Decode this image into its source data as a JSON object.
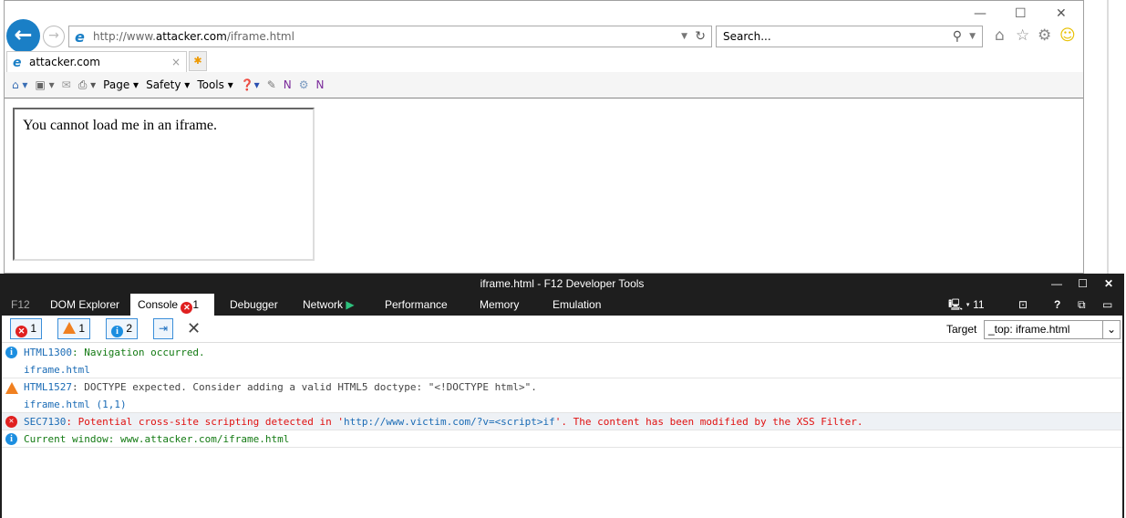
{
  "browser": {
    "url_prefix": "http://www.",
    "url_domain": "attacker.com",
    "url_path": "/iframe.html",
    "search_placeholder": "Search...",
    "tab_title": "attacker.com",
    "command_bar": [
      "Page",
      "Safety",
      "Tools"
    ]
  },
  "page": {
    "iframe_text": "You cannot load me in an iframe."
  },
  "devtools": {
    "title": "iframe.html - F12 Developer Tools",
    "tabs": {
      "f12": "F12",
      "dom": "DOM Explorer",
      "console": "Console",
      "console_errors": "1",
      "debugger": "Debugger",
      "network": "Network",
      "performance": "Performance",
      "memory": "Memory",
      "emulation": "Emulation"
    },
    "doc_mode": "11",
    "filters": {
      "errors": "1",
      "warnings": "1",
      "info": "2"
    },
    "target_label": "Target",
    "target_value": "_top: iframe.html",
    "messages": [
      {
        "type": "info",
        "code": "HTML1300",
        "text": ": Navigation occurred.",
        "source": "iframe.html"
      },
      {
        "type": "warning",
        "code": "HTML1527",
        "text": ": DOCTYPE expected. Consider adding a valid HTML5 doctype: \"<!DOCTYPE html>\".",
        "source": "iframe.html (1,1)"
      },
      {
        "type": "error",
        "code": "SEC7130",
        "text_a": ": Potential cross-site scripting detected in '",
        "url": "http://www.victim.com/?v=<script>if",
        "text_b": "'. The content has been modified by the XSS Filter."
      },
      {
        "type": "info",
        "text": "Current window: www.attacker.com/iframe.html"
      }
    ]
  },
  "colors": {
    "accent": "#1a7fc6",
    "devtools_bg": "#1e1e1e",
    "error": "#e01010"
  }
}
